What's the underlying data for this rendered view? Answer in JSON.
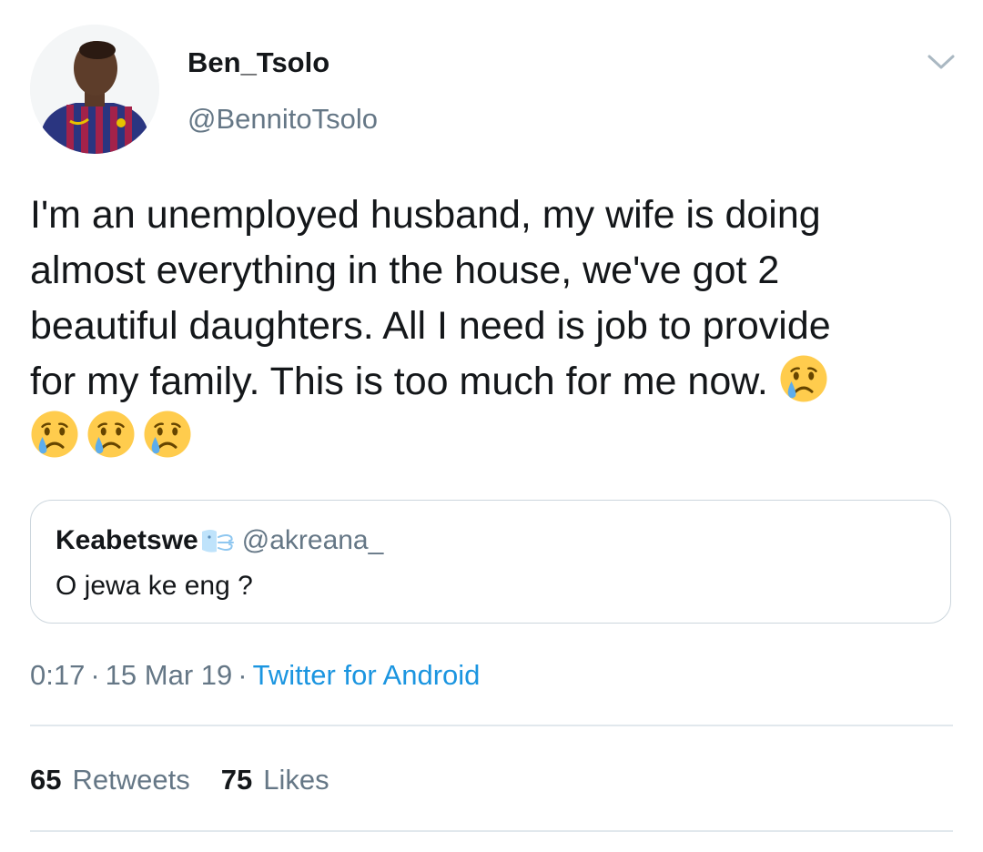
{
  "tweet": {
    "author": {
      "display_name": "Ben_Tsolo",
      "handle": "@BennitoTsolo"
    },
    "text_lines": [
      "I'm an unemployed husband, my wife is doing",
      "almost everything in the house, we've got 2",
      "beautiful daughters. All I need is job to provide",
      "for my family. This is too much for me now."
    ],
    "trailing_emoji": "crying-face",
    "trailing_emoji_count": 4,
    "quoted_tweet": {
      "display_name": "Keabetswe",
      "name_emoji": "wind-face",
      "handle": "@akreana_",
      "text": "O jewa ke eng ?"
    },
    "meta": {
      "time": "0:17",
      "date": "15 Mar 19",
      "separator": "·",
      "source": "Twitter for Android"
    },
    "stats": {
      "retweets_count": "65",
      "retweets_label": "Retweets",
      "likes_count": "75",
      "likes_label": "Likes"
    }
  },
  "colors": {
    "text_primary": "#14171a",
    "text_secondary": "#657786",
    "link": "#1b95e0",
    "border": "#ccd6dd",
    "divider": "#e1e8ed",
    "emoji_face": "#ffcc4d",
    "emoji_tear": "#5dadec"
  }
}
